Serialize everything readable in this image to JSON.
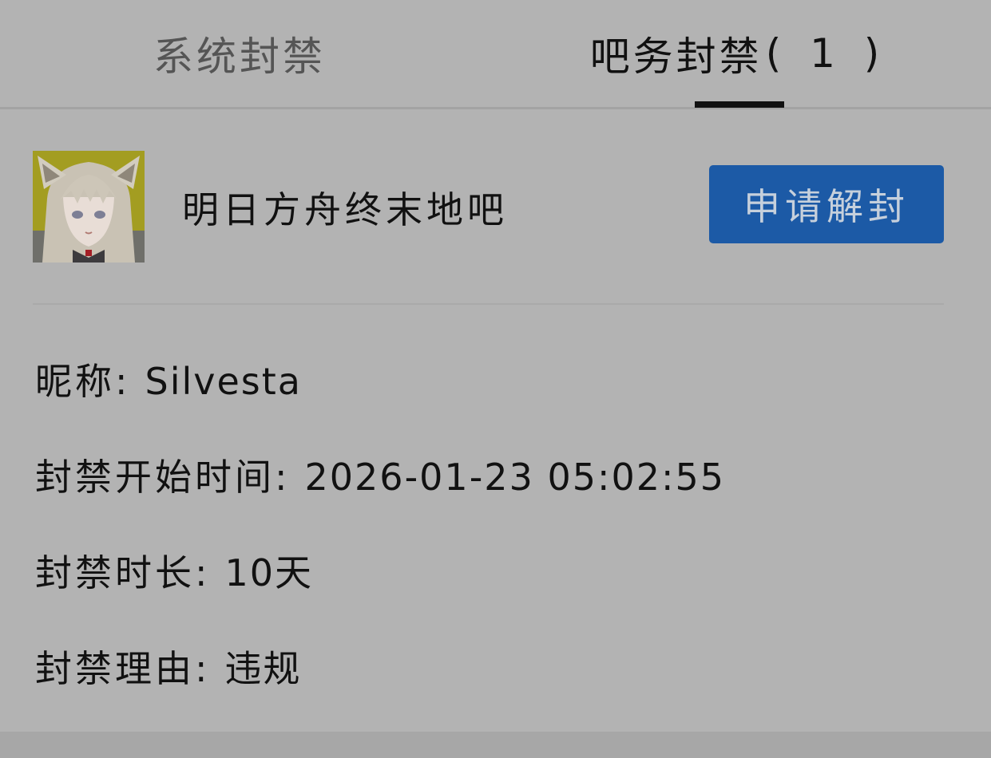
{
  "tabs": [
    {
      "label": "系统封禁",
      "active": false
    },
    {
      "label": "吧务封禁",
      "count": "( 1 )",
      "active": true
    }
  ],
  "forum": {
    "name": "明日方舟终末地吧",
    "avatar_icon": "anime-character-avatar",
    "appeal_label": "申请解封"
  },
  "details": {
    "nickname_label": "昵称:",
    "nickname_value": "Silvesta",
    "start_label": "封禁开始时间:",
    "start_value": "2026-01-23 05:02:55",
    "duration_label": "封禁时长:",
    "duration_value": "10天",
    "reason_label": "封禁理由:",
    "reason_value": "违规"
  },
  "colors": {
    "background": "#b3b3b3",
    "button": "#1c5aa6",
    "text": "#111111",
    "inactive_tab": "#555555"
  }
}
